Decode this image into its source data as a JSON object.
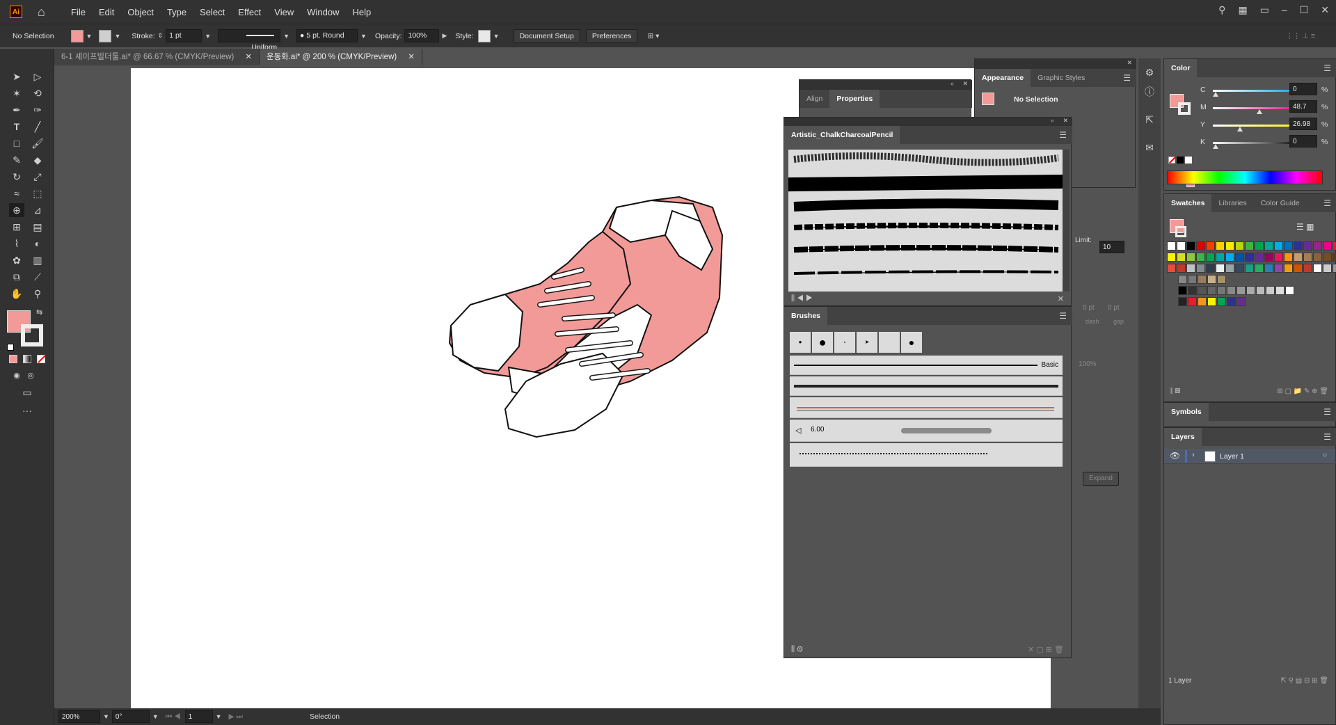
{
  "app": {
    "logo": "Ai"
  },
  "menu": [
    "File",
    "Edit",
    "Object",
    "Type",
    "Select",
    "Effect",
    "View",
    "Window",
    "Help"
  ],
  "control": {
    "selection": "No Selection",
    "stroke_label": "Stroke:",
    "stroke_value": "1 pt",
    "profile": "Uniform",
    "brush": "5 pt. Round",
    "opacity_label": "Opacity:",
    "opacity_value": "100%",
    "style_label": "Style:",
    "document_setup": "Document Setup",
    "preferences": "Preferences"
  },
  "tabs": [
    {
      "label": "6-1 셰이프빌더툴.ai* @ 66.67 % (CMYK/Preview)",
      "active": false
    },
    {
      "label": "운동화.ai* @ 200 % (CMYK/Preview)",
      "active": true
    }
  ],
  "status": {
    "zoom": "200%",
    "rotate": "0°",
    "page": "1",
    "tool": "Selection"
  },
  "align_panel": {
    "tabs": [
      "Align",
      "Properties"
    ],
    "limit_label": "Limit:",
    "limit_value": "10",
    "expand": "Expand",
    "dash": "dash",
    "gap": "gap",
    "zero_pt": "0 pt",
    "pct": "100%"
  },
  "appearance_panel": {
    "tabs": [
      "Appearance",
      "Graphic Styles"
    ],
    "selection": "No Selection"
  },
  "chalk_panel": {
    "title": "Artistic_ChalkCharcoalPencil"
  },
  "brushes_panel": {
    "title": "Brushes",
    "basic_label": "Basic",
    "size_value": "6.00"
  },
  "color_panel": {
    "title": "Color",
    "channels": [
      {
        "label": "C",
        "value": "0",
        "unit": "%",
        "pos": 0.0
      },
      {
        "label": "M",
        "value": "48.7",
        "unit": "%",
        "pos": 0.487
      },
      {
        "label": "Y",
        "value": "26.98",
        "unit": "%",
        "pos": 0.27
      },
      {
        "label": "K",
        "value": "0",
        "unit": "%",
        "pos": 0.0
      }
    ]
  },
  "swatches_panel": {
    "tabs": [
      "Swatches",
      "Libraries",
      "Color Guide"
    ]
  },
  "symbols_panel": {
    "title": "Symbols"
  },
  "layers_panel": {
    "title": "Layers",
    "layer_name": "Layer 1",
    "footer": "1 Layer"
  },
  "colors": {
    "fill": "#f29a98",
    "accent": "#4b6eaf"
  }
}
